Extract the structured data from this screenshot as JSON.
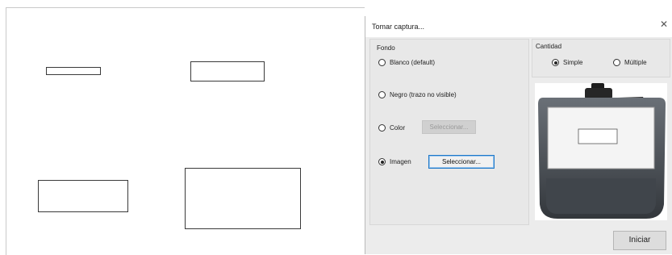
{
  "dialog": {
    "title": "Tomar captura...",
    "close_icon": "close-icon",
    "background_group": {
      "label": "Fondo",
      "options": [
        {
          "label": "Blanco (default)",
          "checked": false
        },
        {
          "label": "Negro (trazo no visible)",
          "checked": false
        },
        {
          "label": "Color",
          "checked": false
        },
        {
          "label": "Imagen",
          "checked": true
        }
      ],
      "color_button_label": "Seleccionar...",
      "image_button_label": "Seleccionar..."
    },
    "quantity_group": {
      "label": "Cantidad",
      "options": [
        {
          "label": "Simple",
          "checked": true
        },
        {
          "label": "Múltiple",
          "checked": false
        }
      ]
    },
    "preview_icon": "signature-pad-icon",
    "start_button_label": "Iniciar"
  },
  "colors": {
    "dialog_bg": "#ececec",
    "accent_border": "#1e78c8",
    "pad_body": "#4a4f55"
  }
}
